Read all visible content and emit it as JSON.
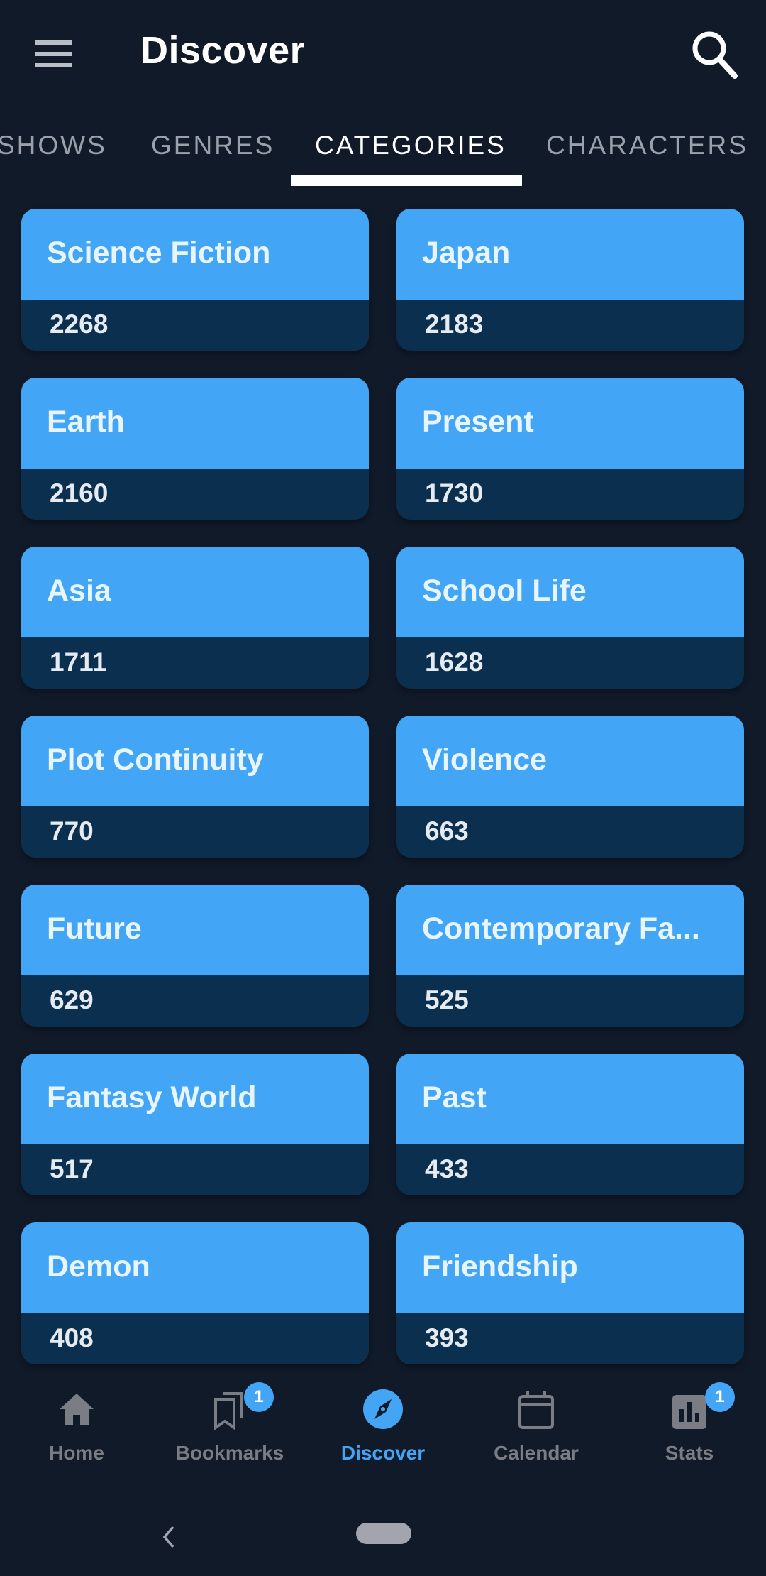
{
  "header": {
    "title": "Discover",
    "menu_icon": "hamburger-menu-icon",
    "search_icon": "search-icon"
  },
  "tabs": [
    {
      "label": "SHOWS",
      "active": false
    },
    {
      "label": "GENRES",
      "active": false
    },
    {
      "label": "CATEGORIES",
      "active": true
    },
    {
      "label": "CHARACTERS",
      "active": false
    }
  ],
  "categories": [
    {
      "name": "Science Fiction",
      "count": "2268"
    },
    {
      "name": "Japan",
      "count": "2183"
    },
    {
      "name": "Earth",
      "count": "2160"
    },
    {
      "name": "Present",
      "count": "1730"
    },
    {
      "name": "Asia",
      "count": "1711"
    },
    {
      "name": "School Life",
      "count": "1628"
    },
    {
      "name": "Plot Continuity",
      "count": "770"
    },
    {
      "name": "Violence",
      "count": "663"
    },
    {
      "name": "Future",
      "count": "629"
    },
    {
      "name": "Contemporary Fa...",
      "count": "525"
    },
    {
      "name": "Fantasy World",
      "count": "517"
    },
    {
      "name": "Past",
      "count": "433"
    },
    {
      "name": "Demon",
      "count": "408"
    },
    {
      "name": "Friendship",
      "count": "393"
    }
  ],
  "bottom_nav": [
    {
      "label": "Home",
      "icon": "home-icon",
      "active": false,
      "badge": null
    },
    {
      "label": "Bookmarks",
      "icon": "bookmarks-icon",
      "active": false,
      "badge": "1"
    },
    {
      "label": "Discover",
      "icon": "compass-icon",
      "active": true,
      "badge": null
    },
    {
      "label": "Calendar",
      "icon": "calendar-icon",
      "active": false,
      "badge": null
    },
    {
      "label": "Stats",
      "icon": "stats-icon",
      "active": false,
      "badge": "1"
    }
  ],
  "colors": {
    "background": "#111a29",
    "card_top": "#43a5f5",
    "card_bottom": "#0b2f4f",
    "accent": "#44a5f4",
    "inactive": "#7a7d83"
  }
}
